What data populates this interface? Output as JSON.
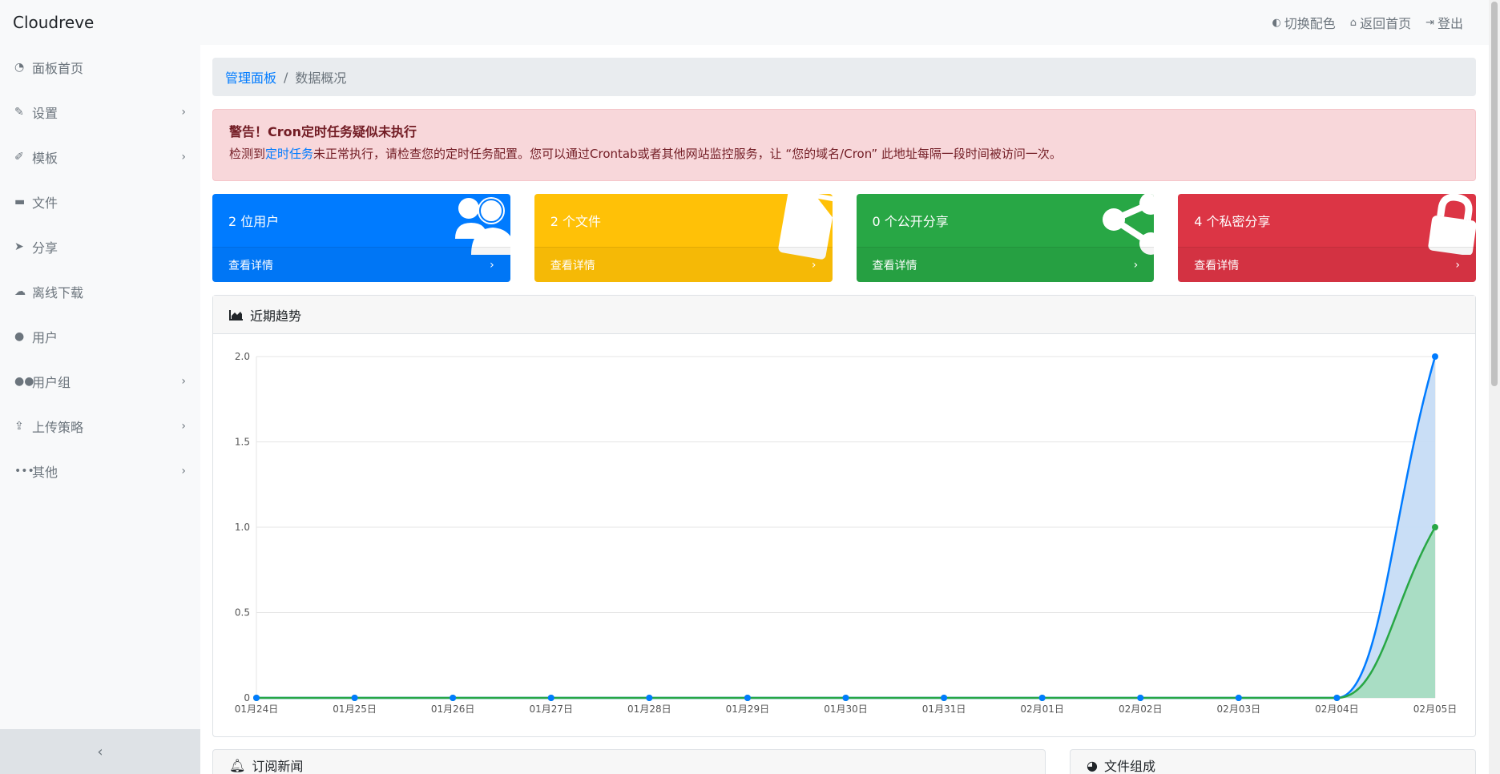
{
  "app": {
    "brand": "Cloudreve"
  },
  "navbar": {
    "theme": "切换配色",
    "home": "返回首页",
    "logout": "登出"
  },
  "sidebar": {
    "items": [
      {
        "label": "面板首页",
        "icon": "dashboard-icon",
        "expandable": false
      },
      {
        "label": "设置",
        "icon": "wrench-icon",
        "expandable": true
      },
      {
        "label": "模板",
        "icon": "paint-brush-icon",
        "expandable": true
      },
      {
        "label": "文件",
        "icon": "folder-icon",
        "expandable": false
      },
      {
        "label": "分享",
        "icon": "paper-plane-icon",
        "expandable": false
      },
      {
        "label": "离线下载",
        "icon": "cloud-download-icon",
        "expandable": false
      },
      {
        "label": "用户",
        "icon": "user-icon",
        "expandable": false
      },
      {
        "label": "用户组",
        "icon": "users-icon",
        "expandable": true
      },
      {
        "label": "上传策略",
        "icon": "upload-icon",
        "expandable": true
      },
      {
        "label": "其他",
        "icon": "ellipsis-icon",
        "expandable": true
      }
    ],
    "collapse": "‹"
  },
  "breadcrumb": {
    "parent": "管理面板",
    "separator": "/",
    "current": "数据概况"
  },
  "alert": {
    "title": "警告！Cron定时任务疑似未执行",
    "text_before": "检测到",
    "link": "定时任务",
    "text_after": "未正常执行，请检查您的定时任务配置。您可以通过Crontab或者其他网站监控服务，让 “您的域名/Cron” 此地址每隔一段时间被访问一次。"
  },
  "cards": [
    {
      "title": "2 位用户",
      "footer": "查看详情",
      "color": "#007bff",
      "icon": "users-icon"
    },
    {
      "title": "2 个文件",
      "footer": "查看详情",
      "color": "#ffc107",
      "icon": "file-icon"
    },
    {
      "title": "0 个公开分享",
      "footer": "查看详情",
      "color": "#28a745",
      "icon": "share-icon"
    },
    {
      "title": "4 个私密分享",
      "footer": "查看详情",
      "color": "#dc3545",
      "icon": "lock-icon"
    }
  ],
  "trend_panel": {
    "title": "近期趋势",
    "icon": "area-chart-icon"
  },
  "chart_data": {
    "type": "area",
    "categories": [
      "01月24日",
      "01月25日",
      "01月26日",
      "01月27日",
      "01月28日",
      "01月29日",
      "01月30日",
      "01月31日",
      "02月01日",
      "02月02日",
      "02月03日",
      "02月04日",
      "02月05日"
    ],
    "series": [
      {
        "color": "#007bff",
        "fill": "#c6dcf5",
        "values": [
          0,
          0,
          0,
          0,
          0,
          0,
          0,
          0,
          0,
          0,
          0,
          0,
          2
        ]
      },
      {
        "color": "#28a745",
        "fill": "#a8dcc1",
        "values": [
          0,
          0,
          0,
          0,
          0,
          0,
          0,
          0,
          0,
          0,
          0,
          0,
          1
        ]
      }
    ],
    "yticks": [
      "0",
      "0.5",
      "1.0",
      "1.5",
      "2.0"
    ],
    "ylim": [
      0,
      2
    ],
    "grid": true
  },
  "bottom_panels": [
    {
      "title": "订阅新闻",
      "icon": "bell-icon"
    },
    {
      "title": "文件组成",
      "icon": "pie-chart-icon"
    }
  ]
}
